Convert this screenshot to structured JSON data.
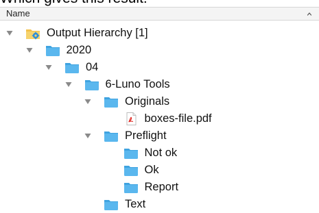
{
  "caption": "Which gives this result:",
  "header": {
    "column_label": "Name",
    "sort_icon": "chevron-up-icon"
  },
  "tree": [
    {
      "label": "Output Hierarchy [1]",
      "level": 0,
      "expanded": true,
      "icon": "smart-folder-gear-icon"
    },
    {
      "label": "2020",
      "level": 1,
      "expanded": true,
      "icon": "folder-icon"
    },
    {
      "label": "04",
      "level": 2,
      "expanded": true,
      "icon": "folder-icon"
    },
    {
      "label": "6-Luno Tools",
      "level": 3,
      "expanded": true,
      "icon": "folder-icon"
    },
    {
      "label": "Originals",
      "level": 4,
      "expanded": true,
      "icon": "folder-icon"
    },
    {
      "label": "boxes-file.pdf",
      "level": 5,
      "expanded": null,
      "icon": "pdf-file-icon"
    },
    {
      "label": "Preflight",
      "level": 4,
      "expanded": true,
      "icon": "folder-icon"
    },
    {
      "label": "Not ok",
      "level": 5,
      "expanded": null,
      "icon": "folder-icon"
    },
    {
      "label": "Ok",
      "level": 5,
      "expanded": null,
      "icon": "folder-icon"
    },
    {
      "label": "Report",
      "level": 5,
      "expanded": null,
      "icon": "folder-icon"
    },
    {
      "label": "Text",
      "level": 4,
      "expanded": null,
      "icon": "folder-icon"
    }
  ],
  "colors": {
    "folder": "#5ab7ee",
    "folder_tab": "#3fa3e0",
    "triangle": "#8a8a8a",
    "pdf_red": "#e0302a"
  }
}
